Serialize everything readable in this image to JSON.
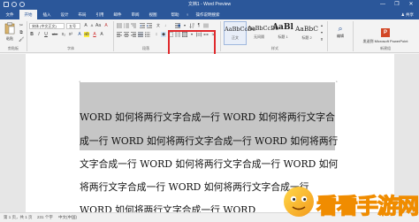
{
  "window": {
    "title": "文档1 - Word Preview",
    "controls": {
      "minimize": "—",
      "restore": "❐",
      "close": "✕"
    }
  },
  "tabs": [
    {
      "label": "文件"
    },
    {
      "label": "开始"
    },
    {
      "label": "插入"
    },
    {
      "label": "设计"
    },
    {
      "label": "布局"
    },
    {
      "label": "引用"
    },
    {
      "label": "邮件"
    },
    {
      "label": "审阅"
    },
    {
      "label": "视图"
    },
    {
      "label": "帮助"
    },
    {
      "label": "♀"
    },
    {
      "label": "操作说明搜索"
    }
  ],
  "share_label": "♟ 共享",
  "ribbon": {
    "clipboard": {
      "paste_label": "粘贴",
      "group_label": "剪贴板"
    },
    "font": {
      "font_name": "宋体 (中文正文)",
      "font_size": "五号",
      "group_label": "字体",
      "buttons": [
        "B",
        "I",
        "U",
        "abc",
        "x₂",
        "x²",
        "A"
      ]
    },
    "paragraph": {
      "group_label": "段落"
    },
    "styles": {
      "group_label": "样式",
      "tiles": [
        {
          "sample": "AaBbCcDc",
          "name": "正文"
        },
        {
          "sample": "AaBbCcDc",
          "name": "无间隔"
        },
        {
          "sample": "AaBl",
          "name": "标题 1"
        },
        {
          "sample": "AaBbC",
          "name": "标题 2"
        }
      ]
    },
    "editing": {
      "label": "编辑"
    },
    "addin": {
      "label": "发送到 Microsoft PowerPoint",
      "group_label": "新建组"
    }
  },
  "document": {
    "lines": [
      "WORD 如何将两行文字合成一行 WORD 如何将两行文字合",
      "成一行 WORD 如何将两行文字合成一行 WORD 如何将两行",
      "文字合成一行 WORD 如何将两行文字合成一行 WORD 如何",
      "将两行文字合成一行 WORD 如何将两行文字合成一行",
      "WORD 如何将两行文字合成一行 WORD"
    ]
  },
  "statusbar": {
    "page": "第 1 页，共 1 页",
    "words": "231 个字",
    "lang": "中文(中国)"
  },
  "watermark": {
    "text": "看看手游网"
  },
  "colors": {
    "title_bar": "#2b579a",
    "ribbon_bg": "#f3f3f3",
    "highlight_border": "#e0292c",
    "selection": "#c6c6c6"
  }
}
